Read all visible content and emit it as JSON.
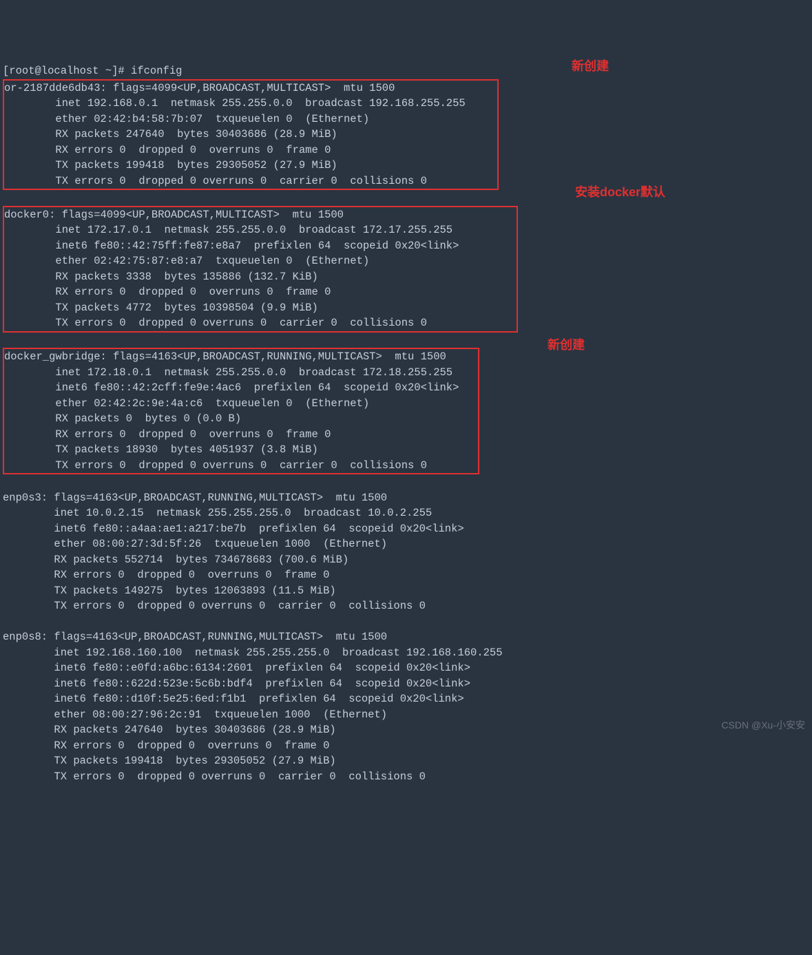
{
  "prompt": "[root@localhost ~]# ifconfig",
  "annotations": {
    "a1": "新创建",
    "a2": "安装docker默认",
    "a3": "新创建"
  },
  "watermark": "CSDN @Xu-小安安",
  "if1": {
    "l1": "or-2187dde6db43: flags=4099<UP,BROADCAST,MULTICAST>  mtu 1500",
    "l2": "        inet 192.168.0.1  netmask 255.255.0.0  broadcast 192.168.255.255",
    "l3": "        ether 02:42:b4:58:7b:07  txqueuelen 0  (Ethernet)",
    "l4": "        RX packets 247640  bytes 30403686 (28.9 MiB)",
    "l5": "        RX errors 0  dropped 0  overruns 0  frame 0",
    "l6": "        TX packets 199418  bytes 29305052 (27.9 MiB)",
    "l7": "        TX errors 0  dropped 0 overruns 0  carrier 0  collisions 0"
  },
  "if2": {
    "l1": "docker0: flags=4099<UP,BROADCAST,MULTICAST>  mtu 1500",
    "l2": "        inet 172.17.0.1  netmask 255.255.0.0  broadcast 172.17.255.255",
    "l3": "        inet6 fe80::42:75ff:fe87:e8a7  prefixlen 64  scopeid 0x20<link>",
    "l4": "        ether 02:42:75:87:e8:a7  txqueuelen 0  (Ethernet)",
    "l5": "        RX packets 3338  bytes 135886 (132.7 KiB)",
    "l6": "        RX errors 0  dropped 0  overruns 0  frame 0",
    "l7": "        TX packets 4772  bytes 10398504 (9.9 MiB)",
    "l8": "        TX errors 0  dropped 0 overruns 0  carrier 0  collisions 0"
  },
  "if3": {
    "l1": "docker_gwbridge: flags=4163<UP,BROADCAST,RUNNING,MULTICAST>  mtu 1500",
    "l2": "        inet 172.18.0.1  netmask 255.255.0.0  broadcast 172.18.255.255",
    "l3": "        inet6 fe80::42:2cff:fe9e:4ac6  prefixlen 64  scopeid 0x20<link>",
    "l4": "        ether 02:42:2c:9e:4a:c6  txqueuelen 0  (Ethernet)",
    "l5": "        RX packets 0  bytes 0 (0.0 B)",
    "l6": "        RX errors 0  dropped 0  overruns 0  frame 0",
    "l7": "        TX packets 18930  bytes 4051937 (3.8 MiB)",
    "l8": "        TX errors 0  dropped 0 overruns 0  carrier 0  collisions 0"
  },
  "if4": {
    "l1": "enp0s3: flags=4163<UP,BROADCAST,RUNNING,MULTICAST>  mtu 1500",
    "l2": "        inet 10.0.2.15  netmask 255.255.255.0  broadcast 10.0.2.255",
    "l3": "        inet6 fe80::a4aa:ae1:a217:be7b  prefixlen 64  scopeid 0x20<link>",
    "l4": "        ether 08:00:27:3d:5f:26  txqueuelen 1000  (Ethernet)",
    "l5": "        RX packets 552714  bytes 734678683 (700.6 MiB)",
    "l6": "        RX errors 0  dropped 0  overruns 0  frame 0",
    "l7": "        TX packets 149275  bytes 12063893 (11.5 MiB)",
    "l8": "        TX errors 0  dropped 0 overruns 0  carrier 0  collisions 0"
  },
  "if5": {
    "l1": "enp0s8: flags=4163<UP,BROADCAST,RUNNING,MULTICAST>  mtu 1500",
    "l2": "        inet 192.168.160.100  netmask 255.255.255.0  broadcast 192.168.160.255",
    "l3": "        inet6 fe80::e0fd:a6bc:6134:2601  prefixlen 64  scopeid 0x20<link>",
    "l4": "        inet6 fe80::622d:523e:5c6b:bdf4  prefixlen 64  scopeid 0x20<link>",
    "l5": "        inet6 fe80::d10f:5e25:6ed:f1b1  prefixlen 64  scopeid 0x20<link>",
    "l6": "        ether 08:00:27:96:2c:91  txqueuelen 1000  (Ethernet)",
    "l7": "        RX packets 247640  bytes 30403686 (28.9 MiB)",
    "l8": "        RX errors 0  dropped 0  overruns 0  frame 0",
    "l9": "        TX packets 199418  bytes 29305052 (27.9 MiB)",
    "l10": "        TX errors 0  dropped 0 overruns 0  carrier 0  collisions 0"
  }
}
